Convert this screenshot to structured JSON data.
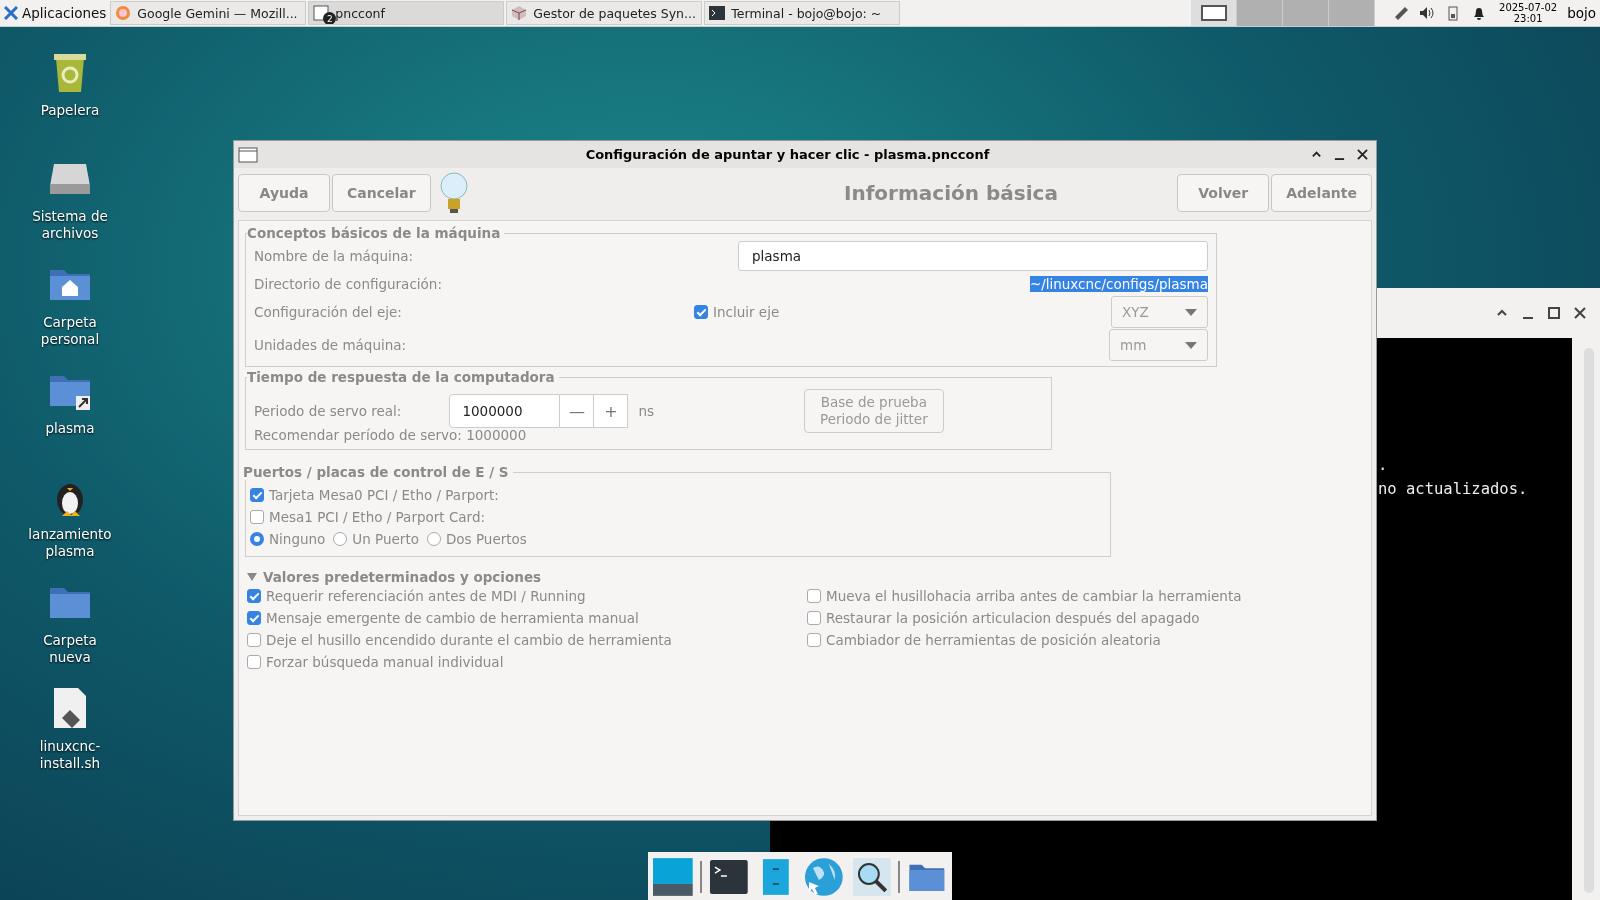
{
  "panel": {
    "app_menu": "Aplicaciones",
    "tasks": [
      {
        "kind": "browser",
        "label": "Google Gemini — Mozill...",
        "selected": false
      },
      {
        "kind": "app",
        "label": "pncconf",
        "badge": "2",
        "selected": true
      },
      {
        "kind": "package",
        "label": "Gestor de paquetes Syn...",
        "selected": false
      },
      {
        "kind": "terminal",
        "label": "Terminal - bojo@bojo: ~",
        "selected": false
      }
    ],
    "workspaces": [
      {
        "selected": true
      },
      {
        "selected": false
      },
      {
        "selected": false
      },
      {
        "selected": false
      }
    ],
    "date": "2025-07-02",
    "time": "23:01",
    "user": "bojo"
  },
  "desktop_icons": [
    {
      "kind": "trash",
      "label": "Papelera"
    },
    {
      "kind": "drive",
      "label": "Sistema de archivos"
    },
    {
      "kind": "home",
      "label": "Carpeta personal"
    },
    {
      "kind": "link",
      "label": "plasma"
    },
    {
      "kind": "penguin",
      "label": "lanzamiento plasma"
    },
    {
      "kind": "folder",
      "label": "Carpeta nueva"
    },
    {
      "kind": "script",
      "label": "linuxcnc-install.sh"
    }
  ],
  "terminal": {
    "lines": [
      ".",
      "no actualizados."
    ]
  },
  "dialog": {
    "title": "Configuración de apuntar y hacer clic - plasma.pncconf",
    "buttons_left": [
      "Ayuda",
      "Cancelar"
    ],
    "heading": "Información básica",
    "buttons_right": [
      "Volver",
      "Adelante"
    ],
    "machine": {
      "legend": "Conceptos básicos de la máquina",
      "rows": [
        {
          "kind": "entry",
          "label": "Nombre de la máquina:",
          "value": "plasma"
        },
        {
          "kind": "path",
          "label": "Directorio de configuración:",
          "value": "~/linuxcnc/configs/plasma"
        },
        {
          "kind": "axis",
          "label": "Configuración del eje:",
          "check_label": "Incluir eje",
          "checked": true,
          "combo": "XYZ"
        },
        {
          "kind": "combo",
          "label": "Unidades de máquina:",
          "combo": "mm"
        }
      ]
    },
    "timing": {
      "legend": "Tiempo de respuesta de la computadora",
      "servo_label": "Periodo de servo real:",
      "servo_value": "1000000",
      "minus": "—",
      "plus": "+",
      "unit": "ns",
      "recommend": "Recomendar período de servo: 1000000",
      "test_button": "Base de prueba\nPeriodo de jitter"
    },
    "ports": {
      "legend": "Puertos / placas de control de E / S",
      "cards": [
        {
          "label": "Tarjeta Mesa0 PCI / Etho / Parport:",
          "checked": true
        },
        {
          "label": "Mesa1 PCI / Etho / Parport Card:",
          "checked": false
        }
      ],
      "radios": [
        {
          "label": "Ninguno",
          "selected": true
        },
        {
          "label": "Un Puerto",
          "selected": false
        },
        {
          "label": "Dos Puertos",
          "selected": false
        }
      ]
    },
    "options": {
      "legend": "Valores predeterminados y opciones",
      "expanded": true,
      "left": [
        {
          "label": "Requerir referenciación antes de MDI / Running",
          "checked": true
        },
        {
          "label": "Mensaje emergente de cambio de herramienta manual",
          "checked": true
        },
        {
          "label": "Deje el husillo encendido durante el cambio de herramienta",
          "checked": false
        },
        {
          "label": "Forzar búsqueda manual individual",
          "checked": false
        }
      ],
      "right": [
        {
          "label": "Mueva el husillohacia arriba antes de cambiar la herramienta",
          "checked": false
        },
        {
          "label": "Restaurar la posición articulacion después del apagado",
          "checked": false
        },
        {
          "label": "Cambiador de herramientas de posición aleatoria",
          "checked": false
        }
      ]
    }
  },
  "dock": [
    {
      "kind": "desktop"
    },
    {
      "kind": "terminal"
    },
    {
      "kind": "files"
    },
    {
      "kind": "web"
    },
    {
      "kind": "search"
    },
    {
      "kind": "folder"
    }
  ]
}
